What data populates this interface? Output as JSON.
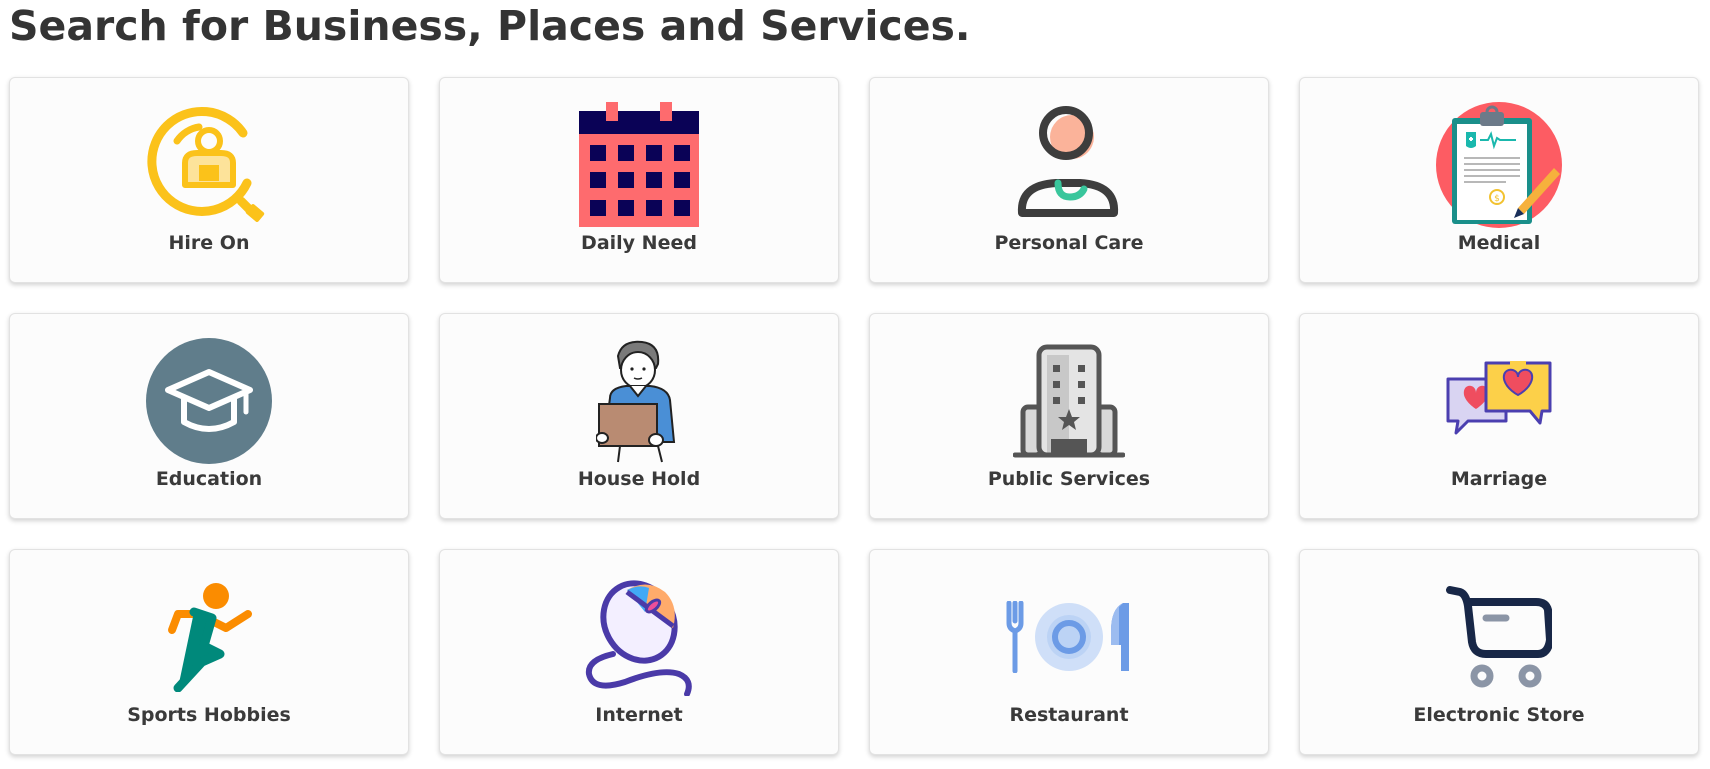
{
  "heading": "Search for Business, Places and Services.",
  "categories": [
    {
      "label": "Hire On",
      "icon": "hire-search-icon"
    },
    {
      "label": "Daily Need",
      "icon": "calendar-icon"
    },
    {
      "label": "Personal Care",
      "icon": "person-icon"
    },
    {
      "label": "Medical",
      "icon": "medical-clipboard-icon"
    },
    {
      "label": "Education",
      "icon": "graduation-cap-icon"
    },
    {
      "label": "House Hold",
      "icon": "person-carrying-box-icon"
    },
    {
      "label": "Public Services",
      "icon": "building-icon"
    },
    {
      "label": "Marriage",
      "icon": "heart-chat-bubbles-icon"
    },
    {
      "label": "Sports Hobbies",
      "icon": "running-person-icon"
    },
    {
      "label": "Internet",
      "icon": "computer-mouse-icon"
    },
    {
      "label": "Restaurant",
      "icon": "plate-cutlery-icon"
    },
    {
      "label": "Electronic Store",
      "icon": "shopping-cart-icon"
    }
  ],
  "colors": {
    "heading": "#343434",
    "card_background": "#fcfcfc",
    "card_border": "#e2e2e2"
  }
}
